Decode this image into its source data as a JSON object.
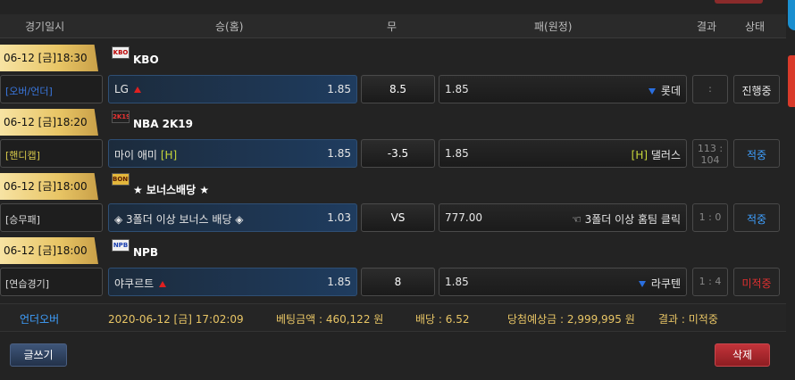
{
  "header": {
    "date": "경기일시",
    "home": "승(홈)",
    "draw": "무",
    "away": "패(원정)",
    "result": "결과",
    "status": "상태"
  },
  "games": [
    {
      "datetime": "06-12 [금]18:30",
      "league_icon": "kbo-logo",
      "league": "KBO",
      "bet_type": "[오버/언더]",
      "bet_type_color": "#3a78e0",
      "home_team": "LG",
      "home_marker": "up-arrow-icon",
      "home_odd": "1.85",
      "draw": "8.5",
      "away_odd": "1.85",
      "away_team": "롯데",
      "away_marker": "down-arrow-icon",
      "result": ":",
      "status": "진행중",
      "status_color": "#e8e8e8"
    },
    {
      "datetime": "06-12 [금]18:20",
      "league_icon": "nba-2k19-logo",
      "league": "NBA 2K19",
      "bet_type": "[핸디캡]",
      "bet_type_color": "#d6c84a",
      "home_team": "마이 애미",
      "home_flag": "[H]",
      "home_odd": "1.85",
      "draw": "-3.5",
      "away_odd": "1.85",
      "away_flag": "[H]",
      "away_team": "댈러스",
      "result": "113 : 104",
      "status": "적중",
      "status_color": "#3fa0ff"
    },
    {
      "datetime": "06-12 [금]18:00",
      "league_icon": "bonus-logo",
      "league": "★ 보너스배당 ★",
      "bet_type": "[승무패]",
      "bet_type_color": "#d8d8d8",
      "home_team": "◈ 3폴더 이상 보너스 배당 ◈",
      "home_odd": "1.03",
      "draw": "VS",
      "away_odd": "777.00",
      "away_team": "☜ 3폴더 이상 홈팀 클릭",
      "result": "1 : 0",
      "status": "적중",
      "status_color": "#3fa0ff"
    },
    {
      "datetime": "06-12 [금]18:00",
      "league_icon": "npb-logo",
      "league": "NPB",
      "bet_type": "[연습경기]",
      "bet_type_color": "#d8d8d8",
      "home_team": "야쿠르트",
      "home_marker": "up-arrow-icon",
      "home_odd": "1.85",
      "draw": "8",
      "away_odd": "1.85",
      "away_team": "라쿠텐",
      "away_marker": "down-arrow-icon",
      "result": "1 : 4",
      "status": "미적중",
      "status_color": "#e03030"
    }
  ],
  "summary": {
    "type": "언더오버",
    "datetime": "2020-06-12 [금] 17:02:09",
    "amount": "베팅금액 : 460,122 원",
    "odds": "배당 : 6.52",
    "expected": "당첨예상금 : 2,999,995 원",
    "result": "결과 : 미적중"
  },
  "buttons": {
    "write": "글쓰기",
    "delete": "삭제"
  },
  "colors": {
    "accent_gold": "#e8c565",
    "hit_blue": "#3fa0ff",
    "miss_red": "#e03030",
    "delete_button": "#a8262c",
    "write_button": "#2d3f5c"
  }
}
